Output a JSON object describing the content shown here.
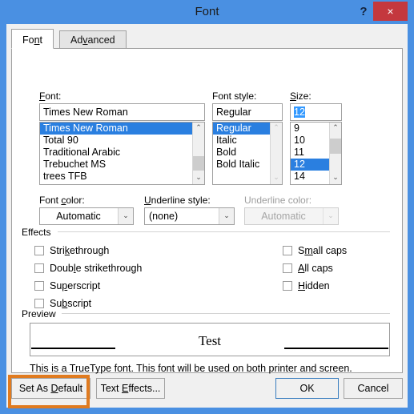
{
  "window": {
    "title": "Font",
    "help_icon": "question-mark-icon",
    "close_icon": "×",
    "titlebar_color": "#4a90e2",
    "close_button_color": "#c4383e"
  },
  "tabs": [
    {
      "label": "Font",
      "accel": "n",
      "active": true
    },
    {
      "label": "Advanced",
      "accel": "v",
      "active": false
    }
  ],
  "font_section": {
    "font": {
      "label": "Font:",
      "accel": "F",
      "value": "Times New Roman",
      "items": [
        "Times New Roman",
        "Total 90",
        "Traditional Arabic",
        "Trebuchet MS",
        "trees TFB"
      ],
      "selected_index": 0,
      "scrollbar": {
        "up_arrow": "⌃",
        "down_arrow": "⌄",
        "thumb_top_pct": 54,
        "thumb_height_pct": 22,
        "enabled": true
      }
    },
    "font_style": {
      "label": "Font style:",
      "value": "Regular",
      "items": [
        "Regular",
        "Italic",
        "Bold",
        "Bold Italic"
      ],
      "selected_index": 0,
      "scrollbar": {
        "up_arrow": "⌃",
        "down_arrow": "⌄",
        "enabled": false
      }
    },
    "size": {
      "label": "Size:",
      "accel": "S",
      "value": "12",
      "value_selected": true,
      "items": [
        "9",
        "10",
        "11",
        "12",
        "14"
      ],
      "selected_index": 3,
      "scrollbar": {
        "up_arrow": "⌃",
        "down_arrow": "⌄",
        "thumb_top_pct": 26,
        "thumb_height_pct": 24,
        "enabled": true
      }
    }
  },
  "color_row": {
    "font_color": {
      "label": "Font color:",
      "accel": "c",
      "value": "Automatic",
      "arrow": "⌄",
      "disabled": false
    },
    "underline_style": {
      "label": "Underline style:",
      "accel": "U",
      "value": "(none)",
      "arrow": "⌄",
      "disabled": false
    },
    "underline_color": {
      "label": "Underline color:",
      "value": "Automatic",
      "arrow": "⌄",
      "disabled": true
    }
  },
  "effects": {
    "title": "Effects",
    "left": [
      {
        "label_pre": "Stri",
        "accel": "k",
        "label_post": "ethrough",
        "checked": false,
        "name": "strikethrough"
      },
      {
        "label_pre": "Doub",
        "accel": "l",
        "label_post": "e strikethrough",
        "checked": false,
        "name": "double-strikethrough"
      },
      {
        "label_pre": "Su",
        "accel": "p",
        "label_post": "erscript",
        "checked": false,
        "name": "superscript"
      },
      {
        "label_pre": "Su",
        "accel": "b",
        "label_post": "script",
        "checked": false,
        "name": "subscript"
      }
    ],
    "right": [
      {
        "label_pre": "S",
        "accel": "m",
        "label_post": "all caps",
        "checked": false,
        "name": "small-caps"
      },
      {
        "label_pre": "",
        "accel": "A",
        "label_post": "ll caps",
        "checked": false,
        "name": "all-caps"
      },
      {
        "label_pre": "",
        "accel": "H",
        "label_post": "idden",
        "checked": false,
        "name": "hidden"
      }
    ]
  },
  "preview": {
    "title": "Preview",
    "sample_text": "Test",
    "description": "This is a TrueType font. This font will be used on both printer and screen."
  },
  "footer": {
    "set_as_default": {
      "label_pre": "Set As ",
      "accel": "D",
      "label_post": "efault"
    },
    "text_effects": {
      "label_pre": "Text ",
      "accel": "E",
      "label_post": "ffects..."
    },
    "ok": {
      "label": "OK",
      "focused": true
    },
    "cancel": {
      "label": "Cancel"
    }
  },
  "annotation": {
    "target": "set-as-default-button",
    "color": "#e07b20"
  }
}
